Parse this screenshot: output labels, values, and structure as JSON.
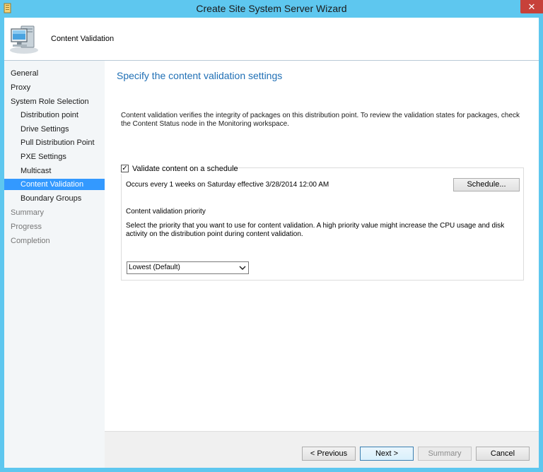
{
  "window": {
    "title": "Create Site System Server Wizard",
    "close_glyph": "✕"
  },
  "header": {
    "title": "Content Validation",
    "icon": "computer-icon"
  },
  "nav": {
    "items": [
      {
        "label": "General",
        "state": "normal"
      },
      {
        "label": "Proxy",
        "state": "normal"
      },
      {
        "label": "System Role Selection",
        "state": "normal"
      },
      {
        "label": "Distribution point",
        "state": "normal"
      },
      {
        "label": "Drive Settings",
        "state": "normal"
      },
      {
        "label": "Pull Distribution Point",
        "state": "normal"
      },
      {
        "label": "PXE Settings",
        "state": "normal"
      },
      {
        "label": "Multicast",
        "state": "normal"
      },
      {
        "label": "Content Validation",
        "state": "selected"
      },
      {
        "label": "Boundary Groups",
        "state": "normal"
      },
      {
        "label": "Summary",
        "state": "disabled"
      },
      {
        "label": "Progress",
        "state": "disabled"
      },
      {
        "label": "Completion",
        "state": "disabled"
      }
    ]
  },
  "main": {
    "heading": "Specify the content validation settings",
    "description": "Content validation verifies the integrity of packages on this distribution point. To review the validation states for packages, check the Content Status node in the Monitoring workspace.",
    "validate_checkbox": {
      "label": "Validate content on a schedule",
      "checked": true,
      "glyph": "✓"
    },
    "schedule_text": "Occurs every 1 weeks on Saturday effective 3/28/2014 12:00 AM",
    "schedule_button": "Schedule...",
    "priority_label": "Content validation priority",
    "priority_description": "Select the priority that you want to use for content validation. A high priority value might increase the CPU usage and disk activity on the distribution point during content validation.",
    "priority_select": {
      "value": "Lowest (Default)"
    }
  },
  "footer": {
    "previous": "< Previous",
    "next": "Next >",
    "summary": "Summary",
    "cancel": "Cancel"
  },
  "colors": {
    "frame": "#5ec7ef",
    "selected_nav": "#3399ff",
    "heading": "#1f6fb5",
    "close_button": "#c7413a"
  }
}
